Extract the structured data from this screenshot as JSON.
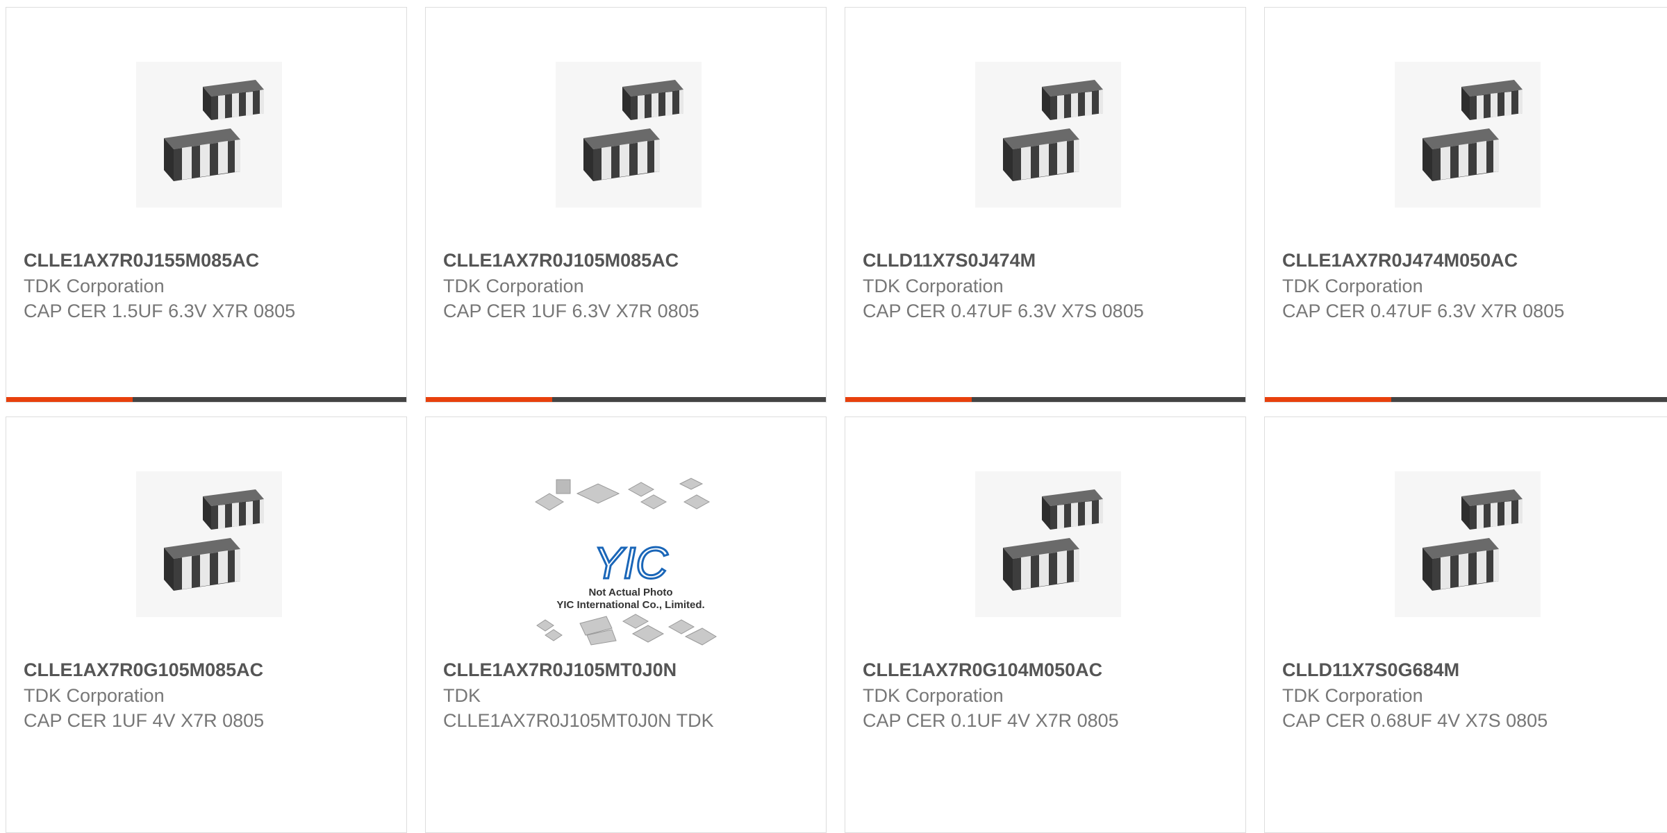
{
  "accent_color": "#e8400c",
  "bar_color": "#444444",
  "products": [
    {
      "part_number": "CLLE1AX7R0J155M085AC",
      "manufacturer": "TDK Corporation",
      "description": "CAP CER 1.5UF 6.3V X7R 0805",
      "image": "capacitor-array-icon"
    },
    {
      "part_number": "CLLE1AX7R0J105M085AC",
      "manufacturer": "TDK Corporation",
      "description": "CAP CER 1UF 6.3V X7R 0805",
      "image": "capacitor-array-icon"
    },
    {
      "part_number": "CLLD11X7S0J474M",
      "manufacturer": "TDK Corporation",
      "description": "CAP CER 0.47UF 6.3V X7S 0805",
      "image": "capacitor-array-icon"
    },
    {
      "part_number": "CLLE1AX7R0J474M050AC",
      "manufacturer": "TDK Corporation",
      "description": "CAP CER 0.47UF 6.3V X7R 0805",
      "image": "capacitor-array-icon"
    },
    {
      "part_number": "CLLE1AX7R0G105M085AC",
      "manufacturer": "TDK Corporation",
      "description": "CAP CER 1UF 4V X7R 0805",
      "image": "capacitor-array-icon"
    },
    {
      "part_number": "CLLE1AX7R0J105MT0J0N",
      "manufacturer": "TDK",
      "description": "CLLE1AX7R0J105MT0J0N TDK",
      "image": "not-actual-photo-placeholder",
      "placeholder_text": [
        "Not Actual Photo",
        "YIC International Co., Limited."
      ],
      "placeholder_logo": "YIC"
    },
    {
      "part_number": "CLLE1AX7R0G104M050AC",
      "manufacturer": "TDK Corporation",
      "description": "CAP CER 0.1UF 4V X7R 0805",
      "image": "capacitor-array-icon"
    },
    {
      "part_number": "CLLD11X7S0G684M",
      "manufacturer": "TDK Corporation",
      "description": "CAP CER 0.68UF 4V X7S 0805",
      "image": "capacitor-array-icon"
    }
  ]
}
